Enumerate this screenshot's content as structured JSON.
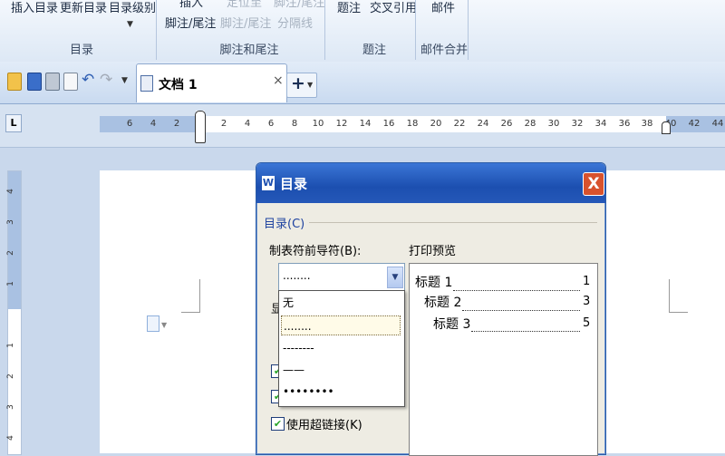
{
  "ribbon": {
    "insert_toc": "插入目录",
    "update_toc": "更新目录",
    "toc_level": "目录级别",
    "insert_footnote_top": "插入",
    "insert_footnote_bottom": "脚注/尾注",
    "locate_top": "定位至",
    "locate_bottom": "脚注/尾注",
    "separator_top": "脚注/尾注",
    "separator_bottom": "分隔线",
    "caption": "题注",
    "cross_ref": "交叉引用",
    "mail": "邮件",
    "groups": {
      "toc": "目录",
      "footnotes": "脚注和尾注",
      "captions": "题注",
      "mail_merge": "邮件合并"
    }
  },
  "tabs": {
    "doc_title": "文档 1",
    "close": "×",
    "new_tab": "+"
  },
  "ruler": {
    "corner": "L",
    "labels": [
      "6",
      "4",
      "2",
      "2",
      "4",
      "6",
      "8",
      "10",
      "12",
      "14",
      "16",
      "18",
      "20",
      "22",
      "24",
      "26",
      "28",
      "30",
      "32",
      "34",
      "36",
      "38",
      "40",
      "42",
      "44"
    ],
    "vlabels": [
      "4",
      "3",
      "2",
      "1",
      "1",
      "2",
      "3",
      "4"
    ]
  },
  "dialog": {
    "title": "目录",
    "app_icon": "W",
    "close": "X",
    "toc_section": "目录(C)",
    "leader_label": "制表符前导符(B):",
    "preview_label": "打印预览",
    "leader_value": "........",
    "leader_options": [
      "无",
      "........",
      "--------",
      "——",
      "••••••••"
    ],
    "partial_label": "显",
    "hyperlink_label": "使用超链接(K)",
    "preview_entries": [
      {
        "text": "标题 1",
        "page": "1"
      },
      {
        "text": "标题 2",
        "page": "3"
      },
      {
        "text": "标题 3",
        "page": "5"
      }
    ]
  },
  "colors": {
    "title_bar": "#1c4fb0",
    "close_button": "#d8522d",
    "checkbox_check": "#2aa52a"
  }
}
